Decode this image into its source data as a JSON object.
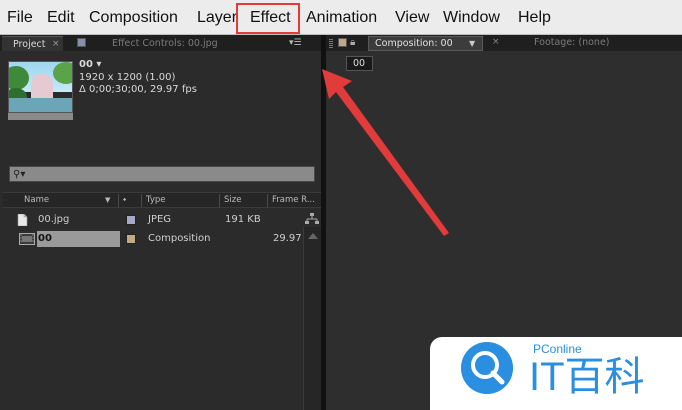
{
  "menu": {
    "items": [
      "File",
      "Edit",
      "Composition",
      "Layer",
      "Effect",
      "Animation",
      "View",
      "Window",
      "Help"
    ],
    "highlighted": "Effect"
  },
  "project_panel": {
    "tab_label": "Project",
    "close_glyph": "×",
    "effect_controls_tab": "Effect Controls: 00.jpg",
    "item": {
      "name": "00 ▾",
      "resolution": "1920 x 1200 (1.00)",
      "duration": "Δ 0;00;30;00, 29.97 fps"
    },
    "search_glyph": "⚲▾",
    "columns": [
      "Name",
      "Type",
      "Size",
      "Frame R..."
    ],
    "rows": [
      {
        "name": "00.jpg",
        "type": "JPEG",
        "size": "191 KB",
        "frame_rate": "",
        "label_color": "#a7a7c8",
        "icon": "image-file-icon",
        "selected": false
      },
      {
        "name": "00",
        "type": "Composition",
        "size": "",
        "frame_rate": "29.97",
        "label_color": "#c1aa86",
        "icon": "composition-icon",
        "selected": true
      }
    ]
  },
  "comp_panel": {
    "comp_tab": "Composition: 00",
    "close_glyph": "×",
    "footage_tab": "Footage: (none)",
    "viewer_label": "00"
  },
  "watermark": {
    "brand": "PConline",
    "mark": "IT百科"
  },
  "colors": {
    "highlight_box": "#e23b3b",
    "arrow": "#e23b3b",
    "watermark": "#2a8fe0"
  }
}
